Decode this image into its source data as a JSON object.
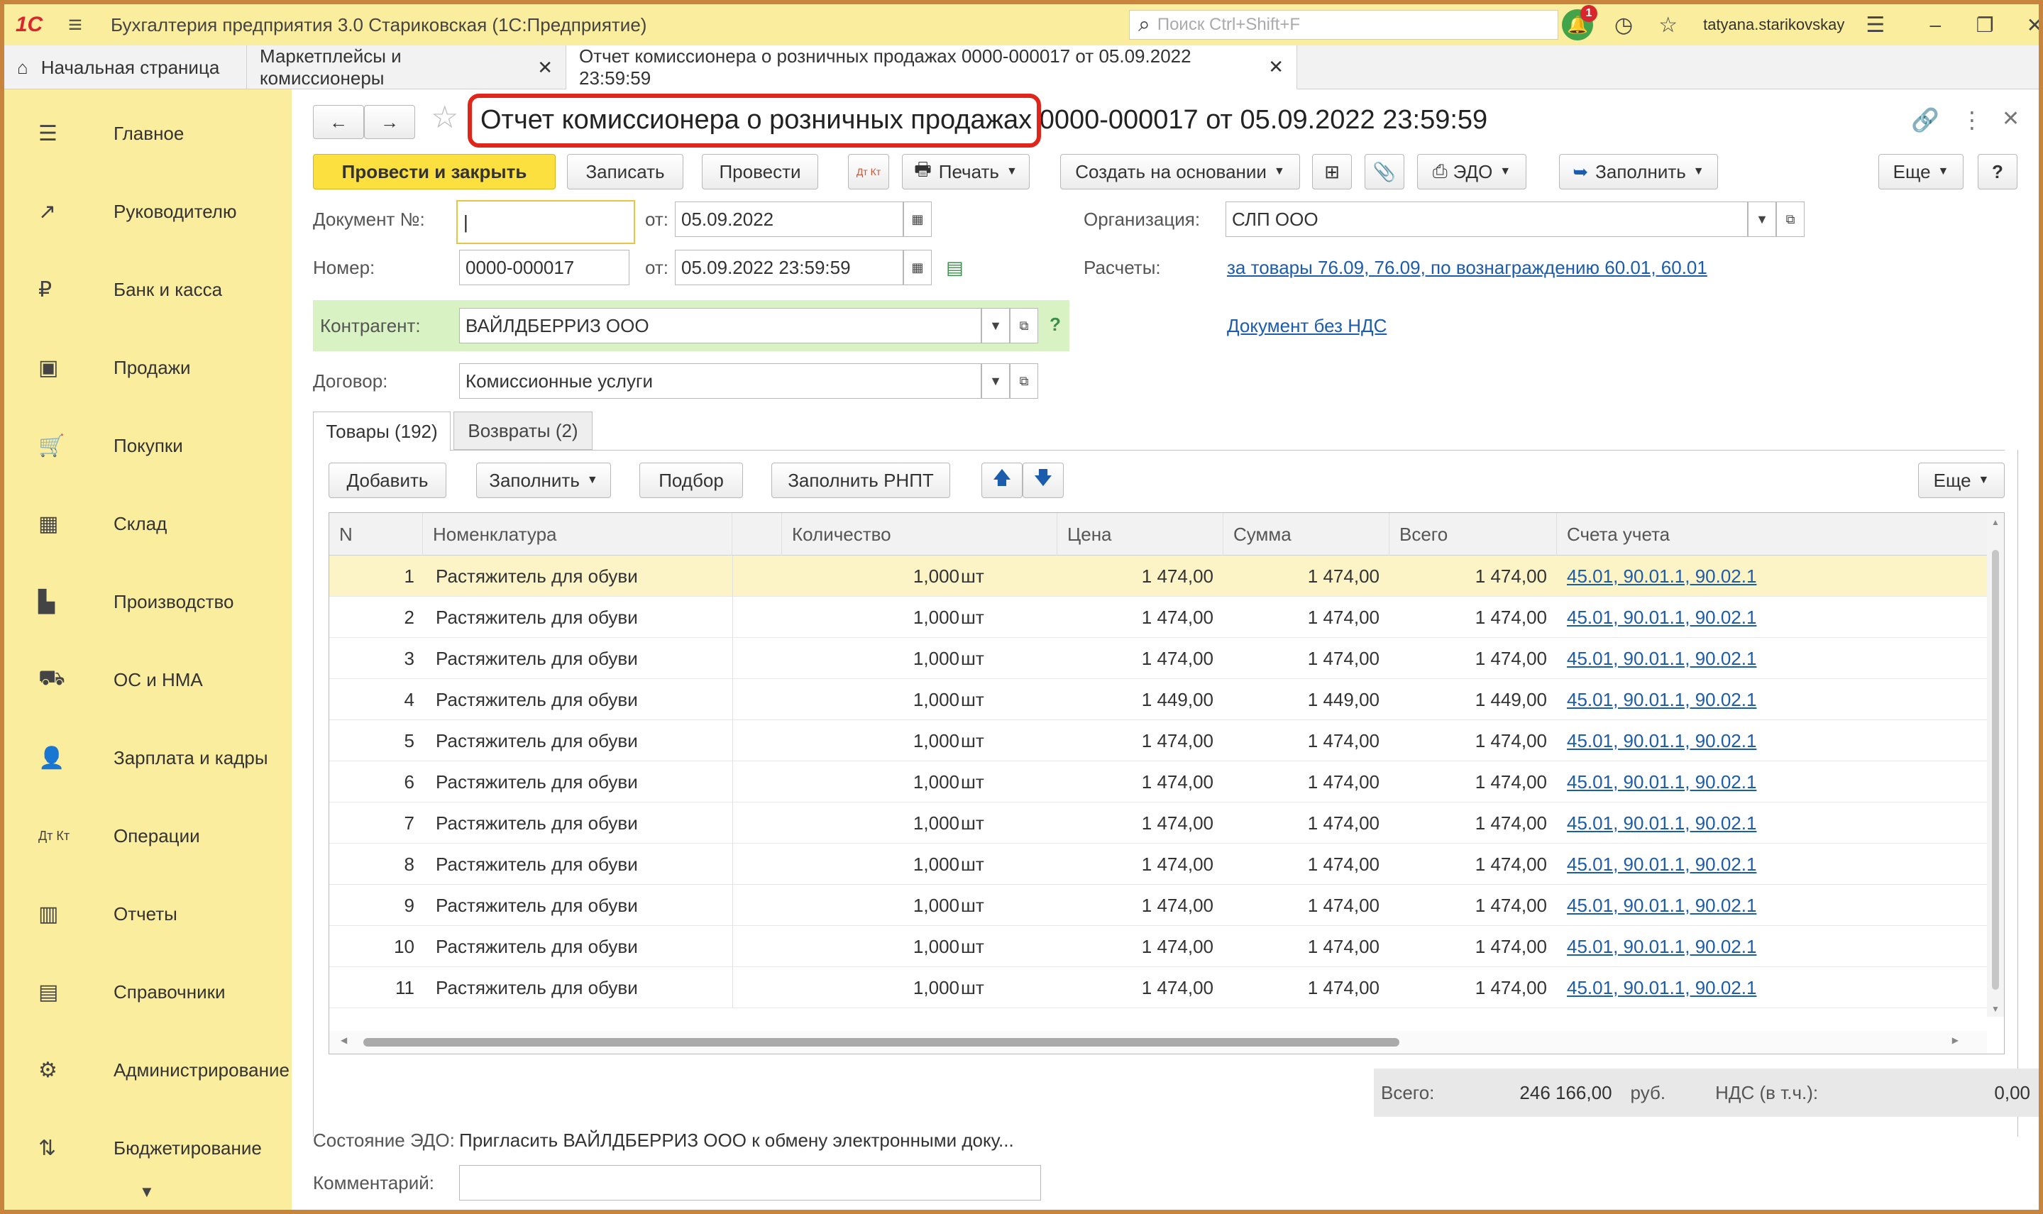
{
  "app": {
    "logo": "1С",
    "title": "Бухгалтерия предприятия 3.0 Стариковская  (1С:Предприятие)",
    "search_placeholder": "Поиск Ctrl+Shift+F",
    "notifications_count": "1",
    "user": "tatyana.starikovskay"
  },
  "tabs": [
    {
      "label": "Начальная страница"
    },
    {
      "label": "Маркетплейсы и комиссионеры"
    },
    {
      "label": "Отчет комиссионера о розничных продажах 0000-000017 от 05.09.2022 23:59:59"
    }
  ],
  "sidebar": {
    "items": [
      {
        "label": "Главное",
        "icon": "menu-icon"
      },
      {
        "label": "Руководителю",
        "icon": "trend-icon"
      },
      {
        "label": "Банк и касса",
        "icon": "ruble-icon"
      },
      {
        "label": "Продажи",
        "icon": "bag-icon"
      },
      {
        "label": "Покупки",
        "icon": "cart-icon"
      },
      {
        "label": "Склад",
        "icon": "warehouse-icon"
      },
      {
        "label": "Производство",
        "icon": "factory-icon"
      },
      {
        "label": "ОС и НМА",
        "icon": "truck-icon"
      },
      {
        "label": "Зарплата и кадры",
        "icon": "person-icon"
      },
      {
        "label": "Операции",
        "icon": "dt-kt-icon"
      },
      {
        "label": "Отчеты",
        "icon": "bar-chart-icon"
      },
      {
        "label": "Справочники",
        "icon": "book-icon"
      },
      {
        "label": "Администрирование",
        "icon": "gear-icon"
      },
      {
        "label": "Бюджетирование",
        "icon": "budget-icon"
      }
    ]
  },
  "document": {
    "title_highlighted": "Отчет комиссионера о розничных продажах",
    "title_rest": " 0000-000017 от 05.09.2022 23:59:59"
  },
  "toolbar": {
    "post_close": "Провести и закрыть",
    "save": "Записать",
    "post": "Провести",
    "dtkt": "Дт Кт",
    "print": "Печать",
    "create_based": "Создать на основании",
    "edo": "ЭДО",
    "fill": "Заполнить",
    "more": "Еще",
    "help": "?"
  },
  "form": {
    "doc_no_label": "Документ №:",
    "doc_no_value": "",
    "from_label": "от:",
    "doc_date": "05.09.2022",
    "number_label": "Номер:",
    "number_value": "0000-000017",
    "number_date": "05.09.2022 23:59:59",
    "org_label": "Организация:",
    "org_value": "СЛП ООО",
    "settlements_label": "Расчеты:",
    "settlements_link": "за товары 76.09, 76.09, по вознаграждению 60.01, 60.01",
    "counterparty_label": "Контрагент:",
    "counterparty_value": "ВАЙЛДБЕРРИЗ ООО",
    "counterparty_help": "?",
    "no_vat_link": "Документ без НДС",
    "contract_label": "Договор:",
    "contract_value": "Комиссионные услуги"
  },
  "subtabs": [
    {
      "label": "Товары (192)"
    },
    {
      "label": "Возвраты (2)"
    }
  ],
  "table_toolbar": {
    "add": "Добавить",
    "fill": "Заполнить",
    "select": "Подбор",
    "fill_rnpt": "Заполнить РНПТ",
    "more": "Еще"
  },
  "table": {
    "headers": {
      "n": "N",
      "nomenclature": "Номенклатура",
      "qty": "Количество",
      "price": "Цена",
      "sum": "Сумма",
      "total": "Всего",
      "accounts": "Счета учета"
    },
    "rows": [
      {
        "n": "1",
        "name": "Растяжитель для обуви",
        "qty": "1,000",
        "unit": "шт",
        "price": "1 474,00",
        "sum": "1 474,00",
        "total": "1 474,00",
        "accounts": "45.01, 90.01.1, 90.02.1"
      },
      {
        "n": "2",
        "name": "Растяжитель для обуви",
        "qty": "1,000",
        "unit": "шт",
        "price": "1 474,00",
        "sum": "1 474,00",
        "total": "1 474,00",
        "accounts": "45.01, 90.01.1, 90.02.1"
      },
      {
        "n": "3",
        "name": "Растяжитель для обуви",
        "qty": "1,000",
        "unit": "шт",
        "price": "1 474,00",
        "sum": "1 474,00",
        "total": "1 474,00",
        "accounts": "45.01, 90.01.1, 90.02.1"
      },
      {
        "n": "4",
        "name": "Растяжитель для обуви",
        "qty": "1,000",
        "unit": "шт",
        "price": "1 449,00",
        "sum": "1 449,00",
        "total": "1 449,00",
        "accounts": "45.01, 90.01.1, 90.02.1"
      },
      {
        "n": "5",
        "name": "Растяжитель для обуви",
        "qty": "1,000",
        "unit": "шт",
        "price": "1 474,00",
        "sum": "1 474,00",
        "total": "1 474,00",
        "accounts": "45.01, 90.01.1, 90.02.1"
      },
      {
        "n": "6",
        "name": "Растяжитель для обуви",
        "qty": "1,000",
        "unit": "шт",
        "price": "1 474,00",
        "sum": "1 474,00",
        "total": "1 474,00",
        "accounts": "45.01, 90.01.1, 90.02.1"
      },
      {
        "n": "7",
        "name": "Растяжитель для обуви",
        "qty": "1,000",
        "unit": "шт",
        "price": "1 474,00",
        "sum": "1 474,00",
        "total": "1 474,00",
        "accounts": "45.01, 90.01.1, 90.02.1"
      },
      {
        "n": "8",
        "name": "Растяжитель для обуви",
        "qty": "1,000",
        "unit": "шт",
        "price": "1 474,00",
        "sum": "1 474,00",
        "total": "1 474,00",
        "accounts": "45.01, 90.01.1, 90.02.1"
      },
      {
        "n": "9",
        "name": "Растяжитель для обуви",
        "qty": "1,000",
        "unit": "шт",
        "price": "1 474,00",
        "sum": "1 474,00",
        "total": "1 474,00",
        "accounts": "45.01, 90.01.1, 90.02.1"
      },
      {
        "n": "10",
        "name": "Растяжитель для обуви",
        "qty": "1,000",
        "unit": "шт",
        "price": "1 474,00",
        "sum": "1 474,00",
        "total": "1 474,00",
        "accounts": "45.01, 90.01.1, 90.02.1"
      },
      {
        "n": "11",
        "name": "Растяжитель для обуви",
        "qty": "1,000",
        "unit": "шт",
        "price": "1 474,00",
        "sum": "1 474,00",
        "total": "1 474,00",
        "accounts": "45.01, 90.01.1, 90.02.1"
      }
    ]
  },
  "totals": {
    "total_label": "Всего:",
    "total_value": "246 166,00",
    "currency": "руб.",
    "vat_label": "НДС (в т.ч.):",
    "vat_value": "0,00"
  },
  "footer": {
    "edo_state_label": "Состояние ЭДО:",
    "edo_state_value": "Пригласить ВАЙЛДБЕРРИЗ ООО к обмену электронными доку...",
    "comment_label": "Комментарий:",
    "comment_value": ""
  },
  "colors": {
    "accent_yellow": "#fce040",
    "sidebar_bg": "#fbed9e",
    "link": "#1c5cad",
    "highlight_red": "#e0251b"
  }
}
